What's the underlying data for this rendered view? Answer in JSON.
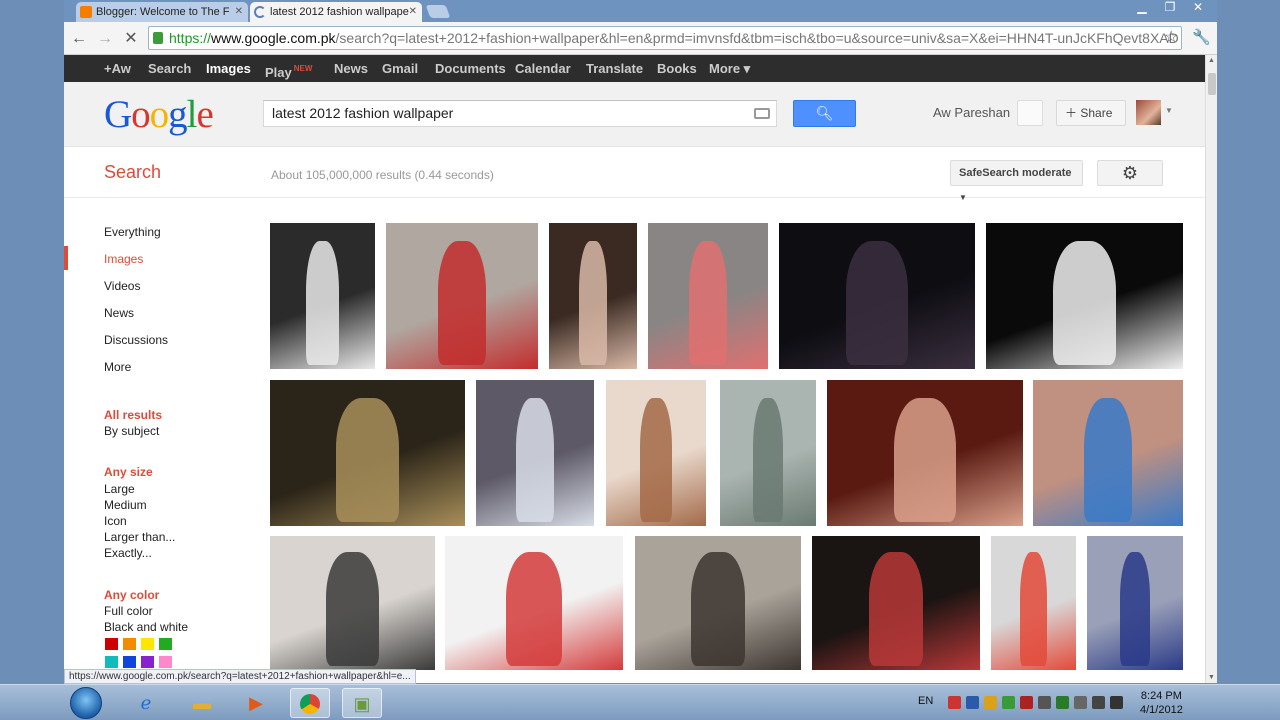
{
  "browser": {
    "tabs": [
      {
        "title": "Blogger: Welcome to The F",
        "active": false
      },
      {
        "title": "latest 2012 fashion wallpape",
        "active": true
      }
    ],
    "url_scheme": "https://",
    "url_host": "www.google.com.pk",
    "url_path": "/search?q=latest+2012+fashion+wallpaper&hl=en&prmd=imvnsfd&tbm=isch&tbo=u&source=univ&sa=X&ei=HHN4T-unJcKFhQevt8XAD",
    "status_url": "https://www.google.com.pk/search?q=latest+2012+fashion+wallpaper&hl=e..."
  },
  "gbar": {
    "items": [
      "+Aw",
      "Search",
      "Images",
      "Play",
      "News",
      "Gmail",
      "Documents",
      "Calendar",
      "Translate",
      "Books",
      "More ▾"
    ],
    "play_badge": "NEW",
    "selected": "Images"
  },
  "header": {
    "logo_letters": [
      "G",
      "o",
      "o",
      "g",
      "l",
      "e"
    ],
    "logo_colors": [
      "#1a57d6",
      "#d8362c",
      "#f4b400",
      "#1a57d6",
      "#1e9e3a",
      "#d8362c"
    ],
    "query": "latest 2012 fashion wallpaper",
    "user_name": "Aw Pareshan",
    "share_label": "Share"
  },
  "results": {
    "title": "Search",
    "stats": "About 105,000,000 results (0.44 seconds)",
    "safesearch_label": "SafeSearch moderate"
  },
  "sidebar": {
    "items": [
      "Everything",
      "Images",
      "Videos",
      "News",
      "Discussions",
      "More"
    ],
    "active": "Images",
    "sections": [
      {
        "heading": "All results",
        "items": [
          "By subject"
        ]
      },
      {
        "heading": "Any size",
        "items": [
          "Large",
          "Medium",
          "Icon",
          "Larger than...",
          "Exactly..."
        ]
      },
      {
        "heading": "Any color",
        "items": [
          "Full color",
          "Black and white"
        ]
      }
    ],
    "color_swatches": [
      "#cc0000",
      "#f28c00",
      "#ffe600",
      "#22aa22",
      "#11bbbb",
      "#1144dd",
      "#8822cc",
      "#ff88cc"
    ]
  },
  "images": {
    "palette": [
      [
        "#2b2b2b",
        "#e9e9e9"
      ],
      [
        "#b0a7a0",
        "#c22d2d"
      ],
      [
        "#3a2a22",
        "#d9b9a7"
      ],
      [
        "#8a8585",
        "#e07070"
      ],
      [
        "#0d0d12",
        "#3b2f3f"
      ],
      [
        "#0a0a0a",
        "#f0f0f0"
      ],
      [
        "#2b2418",
        "#a88f5a"
      ],
      [
        "#5d5966",
        "#d8dde8"
      ],
      [
        "#e9d8cc",
        "#a36a48"
      ],
      [
        "#aab4b0",
        "#6a7a72"
      ],
      [
        "#5a1a12",
        "#d9a08a"
      ],
      [
        "#c09080",
        "#3a7ac8"
      ],
      [
        "#d9d4cf",
        "#3a3a3a"
      ],
      [
        "#f2f2f2",
        "#d43b3b"
      ],
      [
        "#a9a39a",
        "#3d3530"
      ],
      [
        "#1a1412",
        "#b83838"
      ],
      [
        "#d8d8d8",
        "#e34a3a"
      ],
      [
        "#9aa0b8",
        "#2a3a88"
      ]
    ]
  },
  "taskbar": {
    "lang": "EN",
    "time": "8:24 PM",
    "date": "4/1/2012"
  }
}
